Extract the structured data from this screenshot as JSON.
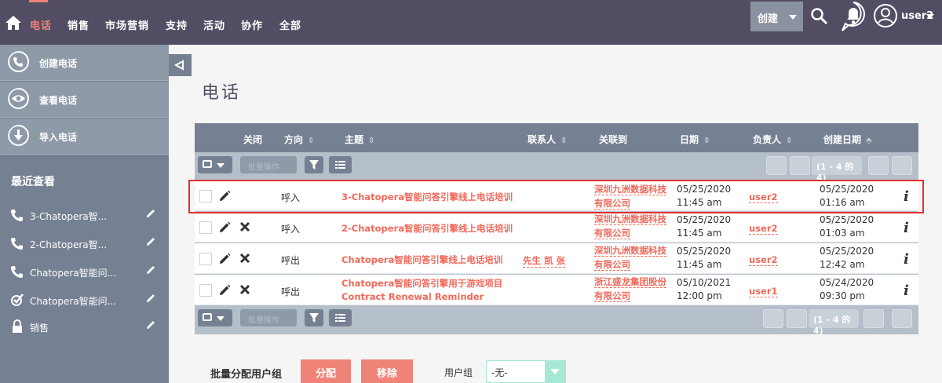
{
  "topnav": {
    "items": [
      "电话",
      "销售",
      "市场营销",
      "支持",
      "活动",
      "协作",
      "全部"
    ],
    "create_label": "创建",
    "user_label": "user2"
  },
  "sidebar": {
    "actions": [
      "创建电话",
      "查看电话",
      "导入电话"
    ],
    "recent_title": "最近查看",
    "recent": [
      {
        "label": "3-Chatopera智...",
        "icon": "phone-icon"
      },
      {
        "label": "2-Chatopera智...",
        "icon": "phone-icon"
      },
      {
        "label": "Chatopera智能问...",
        "icon": "phone-icon"
      },
      {
        "label": "Chatopera智能问...",
        "icon": "check-circle-icon"
      },
      {
        "label": "销售",
        "icon": "lock-icon"
      }
    ]
  },
  "page": {
    "title": "电话"
  },
  "table": {
    "columns": [
      "关闭",
      "方向",
      "主题",
      "联系人",
      "关联到",
      "日期",
      "负责人",
      "创建日期"
    ],
    "bulk_label": "批量操作",
    "pagination_top": "(1 - 4 的 4)",
    "pagination_bottom": "(1 - 4 的 4)",
    "rows": [
      {
        "direction": "呼入",
        "subject": "3-Chatopera智能问答引擎线上电话培训",
        "subject2": "",
        "contact": "",
        "related1": "深圳九洲数据科技",
        "related2": "有限公司",
        "date1": "05/25/2020",
        "date2": "11:45 am",
        "owner": "user2",
        "cdate1": "05/25/2020",
        "cdate2": "01:16 am",
        "info": "i"
      },
      {
        "direction": "呼入",
        "subject": "2-Chatopera智能问答引擎线上电话培训",
        "subject2": "",
        "contact": "",
        "related1": "深圳九洲数据科技",
        "related2": "有限公司",
        "date1": "05/25/2020",
        "date2": "11:45 am",
        "owner": "user2",
        "cdate1": "05/25/2020",
        "cdate2": "01:03 am",
        "info": "i"
      },
      {
        "direction": "呼出",
        "subject": "Chatopera智能问答引擎线上电话培训",
        "subject2": "",
        "contact": "先生 凯 张",
        "related1": "深圳九洲数据科技",
        "related2": "有限公司",
        "date1": "05/25/2020",
        "date2": "11:45 am",
        "owner": "user2",
        "cdate1": "05/25/2020",
        "cdate2": "12:42 am",
        "info": "i"
      },
      {
        "direction": "呼出",
        "subject": "Chatopera智能问答引擎用于游戏项目",
        "subject2": "Contract Renewal Reminder",
        "contact": "",
        "related1": "浙江盛龙集团股份",
        "related2": "有限公司",
        "date1": "05/10/2021",
        "date2": "12:00 pm",
        "owner": "user1",
        "cdate1": "05/24/2020",
        "cdate2": "09:30 pm",
        "info": "i"
      }
    ]
  },
  "mass_assign": {
    "label": "批量分配用户组",
    "assign_label": "分配",
    "remove_label": "移除",
    "group_label": "用户组",
    "group_value": "-无-"
  },
  "colors": {
    "nav_bg": "#534d64",
    "accent": "#f08377",
    "sidebar_bg": "#758092",
    "link": "#f0695a",
    "highlight": "#e3302f"
  }
}
